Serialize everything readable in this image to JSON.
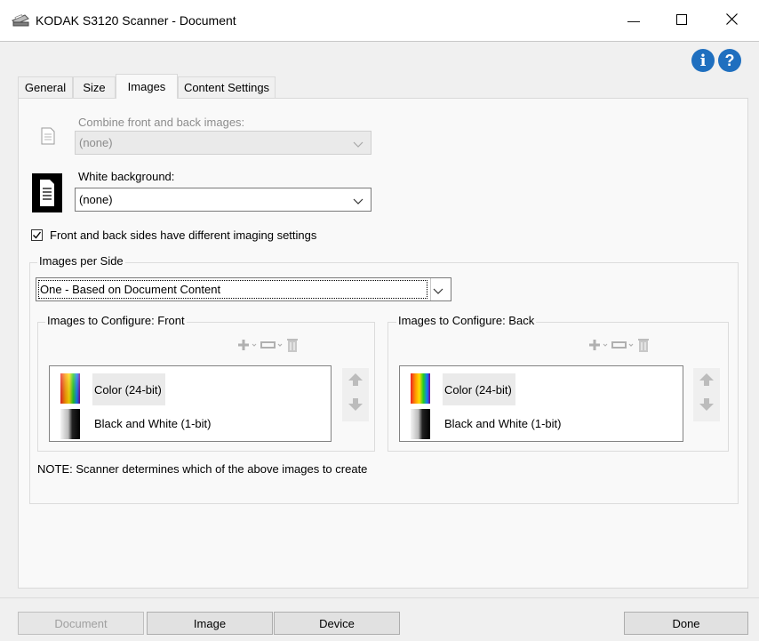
{
  "window": {
    "title": "KODAK S3120 Scanner - Document",
    "minimize_symbol": "—",
    "maximize_symbol": "☐",
    "close_symbol": "✕"
  },
  "help": {
    "info_glyph": "i",
    "help_glyph": "?"
  },
  "tabs": [
    {
      "label": "General"
    },
    {
      "label": "Size"
    },
    {
      "label": "Images"
    },
    {
      "label": "Content Settings"
    }
  ],
  "combine": {
    "label": "Combine front and back images:",
    "value": "(none)"
  },
  "white_background": {
    "label": "White background:",
    "value": "(none)"
  },
  "different_settings": {
    "label": "Front and back sides have different imaging settings",
    "checked": true
  },
  "images_per_side": {
    "group_label": "Images per Side",
    "value": "One - Based on Document Content"
  },
  "front": {
    "group_label": "Images to Configure: Front",
    "items": [
      {
        "label": "Color (24-bit)"
      },
      {
        "label": "Black and White (1-bit)"
      }
    ]
  },
  "back": {
    "group_label": "Images to Configure: Back",
    "items": [
      {
        "label": "Color (24-bit)"
      },
      {
        "label": "Black and White (1-bit)"
      }
    ]
  },
  "note": "NOTE: Scanner determines which of the above images to create",
  "bottom_buttons": {
    "document": "Document",
    "image": "Image",
    "device": "Device",
    "done": "Done"
  },
  "colors": {
    "accent_blue": "#1f6fbf",
    "disabled_text": "#a0a0a0"
  }
}
